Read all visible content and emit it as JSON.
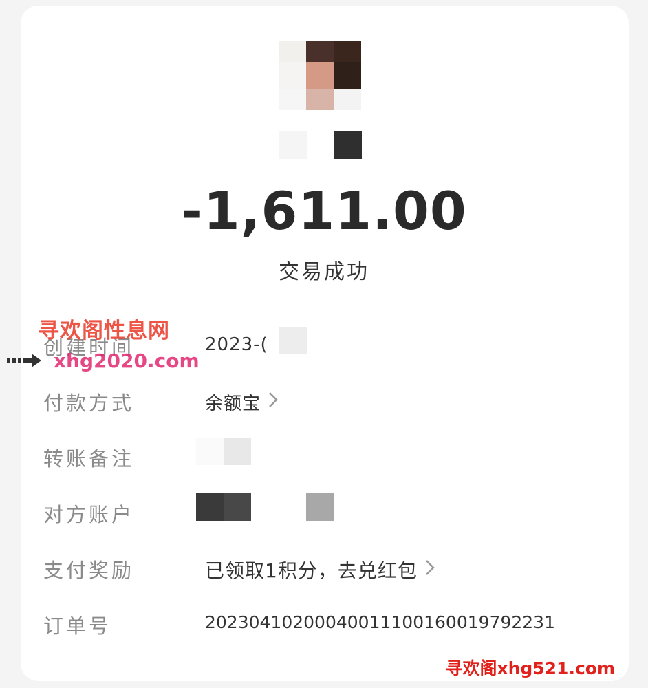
{
  "transaction": {
    "amount": "-1,611.00",
    "status": "交易成功"
  },
  "details": {
    "created_time_label": "创建时间",
    "created_time_value": "2023-(",
    "payment_method_label": "付款方式",
    "payment_method_value": "余额宝",
    "transfer_note_label": "转账备注",
    "counterparty_label": "对方账户",
    "reward_label": "支付奖励",
    "reward_value": "已领取1积分，去兑红包",
    "order_label": "订单号",
    "order_value": "20230410200040011100160019792231"
  },
  "watermarks": {
    "site_name": "寻欢阁性息网",
    "site_url": "xhg2020.com",
    "bottom_mark": "寻欢阁xhg521.com"
  },
  "icons": {
    "chevron": "chevron-right-icon",
    "arrow": "arrow-right-icon"
  },
  "colors": {
    "label": "#8a8a8a",
    "value": "#333333",
    "amount": "#2a2a2a",
    "watermark_red": "#e0211c"
  }
}
